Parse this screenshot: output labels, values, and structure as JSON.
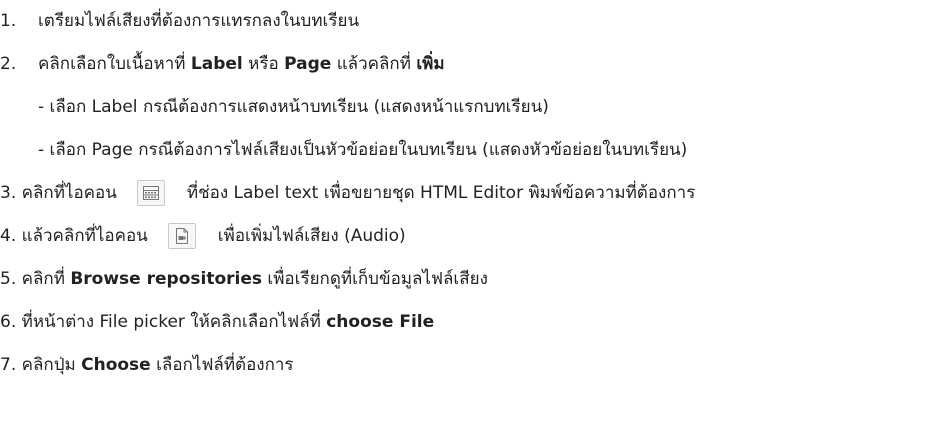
{
  "steps": {
    "s1": {
      "number": "1.",
      "text": "เตรียมไฟล์เสียงที่ต้องการแทรกลงในบทเรียน"
    },
    "s2": {
      "number": "2.",
      "prefix": "คลิกเลือกใบเนื้อหาที่ ",
      "label": "Label",
      "or": " หรือ ",
      "page": "Page",
      "mid": " แล้วคลิกที่ ",
      "add": "เพิ่ม"
    },
    "s2a": "- เลือก Label กรณีต้องการแสดงหน้าบทเรียน (แสดงหน้าแรกบทเรียน)",
    "s2b": "- เลือก Page กรณีต้องการไฟล์เสียงเป็นหัวข้อย่อยในบทเรียน (แสดงหัวข้อย่อยในบทเรียน)",
    "s3": {
      "prefix": "3. คลิกที่ไอคอน",
      "icon": "toolbar-toggle-icon",
      "suffix": "ที่ช่อง Label text เพื่อขยายชุด HTML Editor พิมพ์ข้อความที่ต้องการ"
    },
    "s4": {
      "prefix": "4. แล้วคลิกที่ไอคอน",
      "icon": "media-insert-icon",
      "suffix": "เพื่อเพิ่มไฟล์เสียง (Audio)"
    },
    "s5": {
      "prefix": "5. คลิกที่ ",
      "bold": "Browse repositories",
      "suffix": " เพื่อเรียกดูที่เก็บข้อมูลไฟล์เสียง"
    },
    "s6": {
      "prefix": "6. ที่หน้าต่าง File picker ให้คลิกเลือกไฟล์ที่ ",
      "bold": "choose File"
    },
    "s7": {
      "prefix": "7. คลิกปุ่ม ",
      "bold": "Choose",
      "suffix": " เลือกไฟล์ที่ต้องการ"
    }
  },
  "colors": {
    "text": "#222222",
    "icon_border": "#c8c8c8",
    "icon_stroke": "#777777"
  }
}
